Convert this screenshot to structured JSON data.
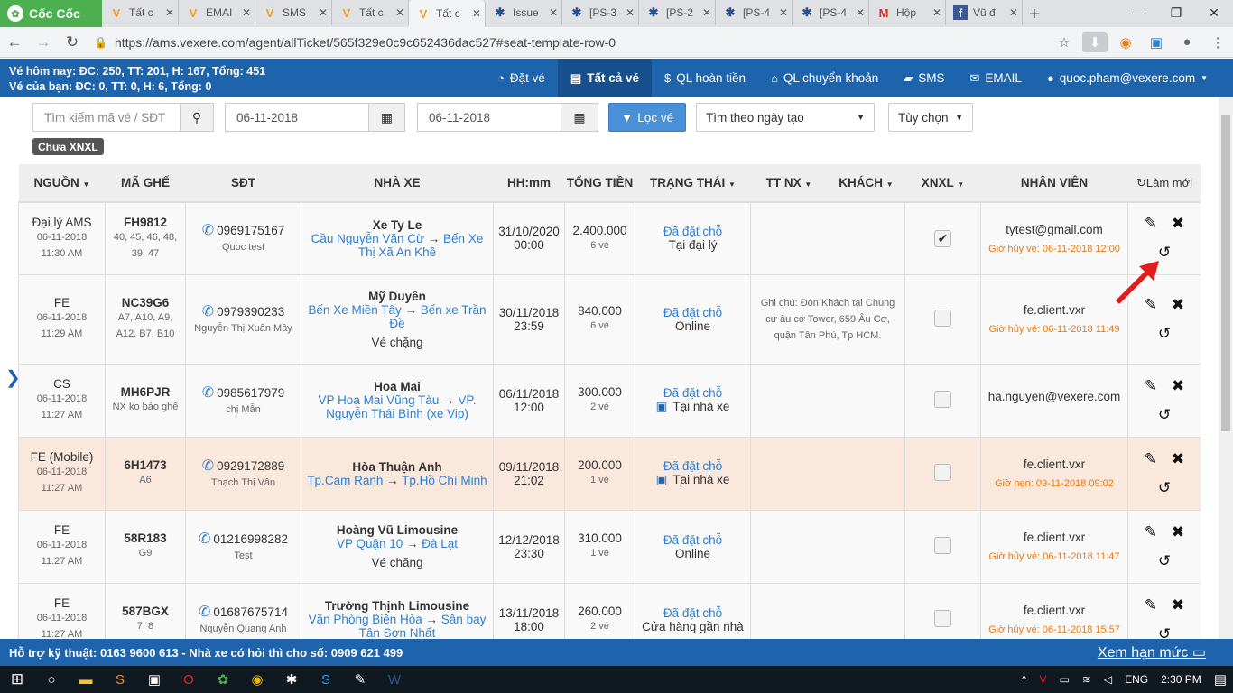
{
  "browser": {
    "brand": "Cốc Cốc",
    "tabs": [
      {
        "title": "Tất c",
        "icon": "vexere-icon",
        "active": false
      },
      {
        "title": "EMAI",
        "icon": "vexere-icon",
        "active": false
      },
      {
        "title": "SMS",
        "icon": "vexere-icon",
        "active": false
      },
      {
        "title": "Tất c",
        "icon": "vexere-icon",
        "active": false
      },
      {
        "title": "Tất c",
        "icon": "vexere-icon",
        "active": true
      },
      {
        "title": "Issue",
        "icon": "jira-icon",
        "active": false
      },
      {
        "title": "[PS-3",
        "icon": "jira-icon",
        "active": false
      },
      {
        "title": "[PS-2",
        "icon": "jira-icon",
        "active": false
      },
      {
        "title": "[PS-4",
        "icon": "jira-icon",
        "active": false
      },
      {
        "title": "[PS-4",
        "icon": "jira-icon",
        "active": false
      },
      {
        "title": "Hộp",
        "icon": "gmail-icon",
        "active": false
      },
      {
        "title": "Vũ đ",
        "icon": "facebook-icon",
        "active": false
      }
    ],
    "url": "https://ams.vexere.com/agent/allTicket/565f329e0c9c652436dac527#seat-template-row-0"
  },
  "header": {
    "stats_today": "Vé hôm nay: ĐC: 250, TT: 201, H: 167, Tổng: 451",
    "stats_mine": "Vé của bạn: ĐC: 0, TT: 0, H: 6, Tổng: 0",
    "nav": [
      {
        "label": "Đặt vé",
        "icon": "clock-check-icon"
      },
      {
        "label": "Tất cả vé",
        "icon": "document-icon",
        "active": true
      },
      {
        "label": "QL hoàn tiền",
        "icon": "dollar-icon"
      },
      {
        "label": "QL chuyển khoản",
        "icon": "bank-icon"
      },
      {
        "label": "SMS",
        "icon": "chat-icon"
      },
      {
        "label": "EMAIL",
        "icon": "envelope-icon"
      },
      {
        "label": "quoc.pham@vexere.com",
        "icon": "user-icon"
      }
    ]
  },
  "filters": {
    "search_placeholder": "Tìm kiếm mã vé / SĐT",
    "date_from": "06-11-2018",
    "date_to": "06-11-2018",
    "filter_button": "Lọc vé",
    "date_type": "Tìm theo ngày tạo",
    "options": "Tùy chọn",
    "status_badge": "Chưa XNXL"
  },
  "table": {
    "headers": [
      "NGUỒN",
      "MÃ GHẾ",
      "SĐT",
      "NHÀ XE",
      "HH:mm",
      "TỔNG TIỀN",
      "TRẠNG THÁI",
      "TT NX",
      "KHÁCH",
      "XNXL",
      "NHÂN VIÊN"
    ],
    "refresh": "Làm mới",
    "rows": [
      {
        "source": "Đại lý AMS",
        "date": "06-11-2018",
        "time": "11:30 AM",
        "code": "FH9812",
        "seats": "40, 45, 46, 48, 39, 47",
        "phone": "0969175167",
        "name": "Quoc test",
        "operator": "Xe Ty Le",
        "from": "Cầu Nguyễn Văn Cừ",
        "to": "Bến Xe Thị Xã An Khê",
        "extra": "",
        "dep_date": "31/10/2020",
        "dep_time": "00:00",
        "total": "2.400.000",
        "qty": "6 vé",
        "status": "Đã đặt chỗ",
        "channel": "Tại đại lý",
        "bus": false,
        "note": "",
        "checked": true,
        "staff": "tytest@gmail.com",
        "cancel": "Giờ hủy vé: 06-11-2018 12:00"
      },
      {
        "source": "FE",
        "date": "06-11-2018",
        "time": "11:29 AM",
        "code": "NC39G6",
        "seats": "A7, A10, A9, A12, B7, B10",
        "phone": "0979390233",
        "name": "Nguyễn Thị Xuân Mây",
        "operator": "Mỹ Duyên",
        "from": "Bến Xe Miền Tây",
        "to": "Bến xe Trần Đề",
        "extra": "Vé chặng",
        "dep_date": "30/11/2018",
        "dep_time": "23:59",
        "total": "840.000",
        "qty": "6 vé",
        "status": "Đã đặt chỗ",
        "channel": "Online",
        "bus": false,
        "note": "Ghi chú: Đón Khách tại Chung cư âu cơ Tower, 659 Âu Cơ, quận Tân Phú, Tp HCM.",
        "checked": false,
        "staff": "fe.client.vxr",
        "cancel": "Giờ hủy vé: 06-11-2018 11:49"
      },
      {
        "source": "CS",
        "date": "06-11-2018",
        "time": "11:27 AM",
        "code": "MH6PJR",
        "seats": "NX ko báo ghế",
        "phone": "0985617979",
        "name": "chị Mẫn",
        "operator": "Hoa Mai",
        "from": "VP Hoa Mai Vũng Tàu",
        "to": "VP. Nguyễn Thái Bình (xe Vip)",
        "extra": "",
        "dep_date": "06/11/2018",
        "dep_time": "12:00",
        "total": "300.000",
        "qty": "2 vé",
        "status": "Đã đặt chỗ",
        "channel": "Tại nhà xe",
        "bus": true,
        "note": "",
        "checked": false,
        "staff": "ha.nguyen@vexere.com",
        "cancel": ""
      },
      {
        "source": "FE (Mobile)",
        "date": "06-11-2018",
        "time": "11:27 AM",
        "code": "6H1473",
        "seats": "A6",
        "phone": "0929172889",
        "name": "Thạch Thị Vân",
        "operator": "Hòa Thuận Anh",
        "from": "Tp.Cam Ranh",
        "to": "Tp.Hồ Chí Minh",
        "extra": "",
        "dep_date": "09/11/2018",
        "dep_time": "21:02",
        "total": "200.000",
        "qty": "1 vé",
        "status": "Đã đặt chỗ",
        "channel": "Tại nhà xe",
        "bus": true,
        "note": "",
        "checked": false,
        "staff": "fe.client.vxr",
        "cancel": "Giờ hẹn: 09-11-2018 09:02",
        "highlight": true
      },
      {
        "source": "FE",
        "date": "06-11-2018",
        "time": "11:27 AM",
        "code": "58R183",
        "seats": "G9",
        "phone": "01216998282",
        "name": "Test",
        "operator": "Hoàng Vũ Limousine",
        "from": "VP Quận 10",
        "to": "Đà Lạt",
        "extra": "Vé chặng",
        "dep_date": "12/12/2018",
        "dep_time": "23:30",
        "total": "310.000",
        "qty": "1 vé",
        "status": "Đã đặt chỗ",
        "channel": "Online",
        "bus": false,
        "note": "",
        "checked": false,
        "staff": "fe.client.vxr",
        "cancel": "Giờ hủy vé: 06-11-2018 11:47"
      },
      {
        "source": "FE",
        "date": "06-11-2018",
        "time": "11:27 AM",
        "code": "587BGX",
        "seats": "7, 8",
        "phone": "01687675714",
        "name": "Nguyễn Quang Anh",
        "operator": "Trường Thịnh Limousine",
        "from": "Văn Phòng Biên Hòa",
        "to": "Sân bay Tân Sơn Nhất",
        "extra": "",
        "dep_date": "13/11/2018",
        "dep_time": "18:00",
        "total": "260.000",
        "qty": "2 vé",
        "status": "Đã đặt chỗ",
        "channel": "Cửa hàng gần nhà",
        "bus": false,
        "note": "",
        "checked": false,
        "staff": "fe.client.vxr",
        "cancel": "Giờ hủy vé: 06-11-2018 15:57"
      }
    ]
  },
  "footer": {
    "support": "Hỗ trợ kỹ thuật: 0163 9600 613 - Nhà xe có hỏi thì cho số: 0909 621 499",
    "limit_link": "Xem hạn mức"
  },
  "taskbar": {
    "lang": "ENG",
    "clock": "2:30 PM"
  },
  "colors": {
    "brand_blue": "#1e64ad",
    "link_blue": "#2f7fd0",
    "orange": "#f0780a",
    "highlight_row": "#fbe8dc"
  }
}
